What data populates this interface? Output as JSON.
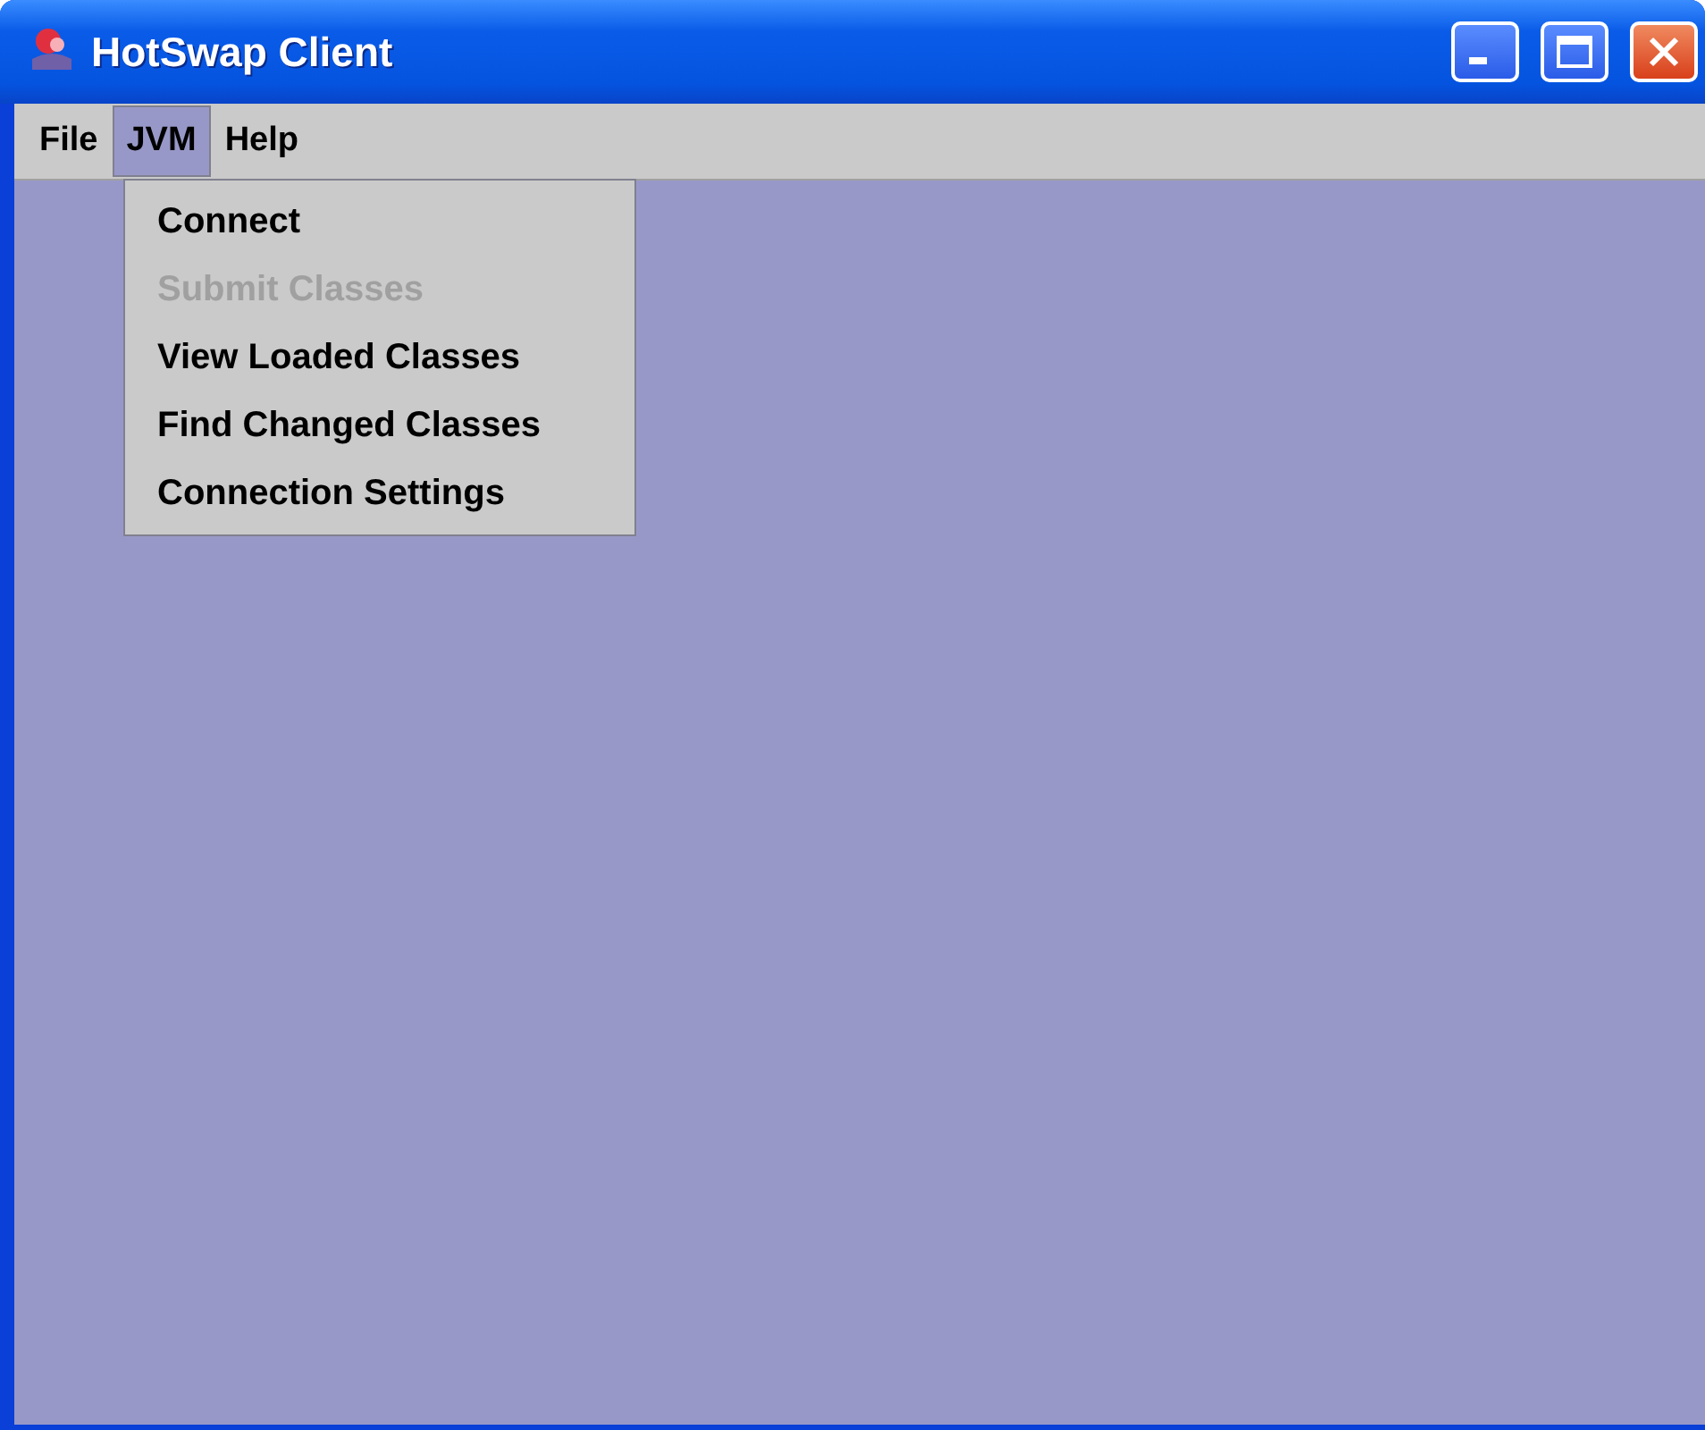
{
  "window": {
    "title": "HotSwap Client"
  },
  "menubar": [
    {
      "label": "File",
      "selected": false
    },
    {
      "label": "JVM",
      "selected": true
    },
    {
      "label": "Help",
      "selected": false
    }
  ],
  "open_menu": {
    "items": [
      {
        "label": "Connect",
        "disabled": false
      },
      {
        "label": "Submit Classes",
        "disabled": true
      },
      {
        "label": "View Loaded Classes",
        "disabled": false
      },
      {
        "label": "Find Changed Classes",
        "disabled": false
      },
      {
        "label": "Connection Settings",
        "disabled": false
      }
    ]
  }
}
